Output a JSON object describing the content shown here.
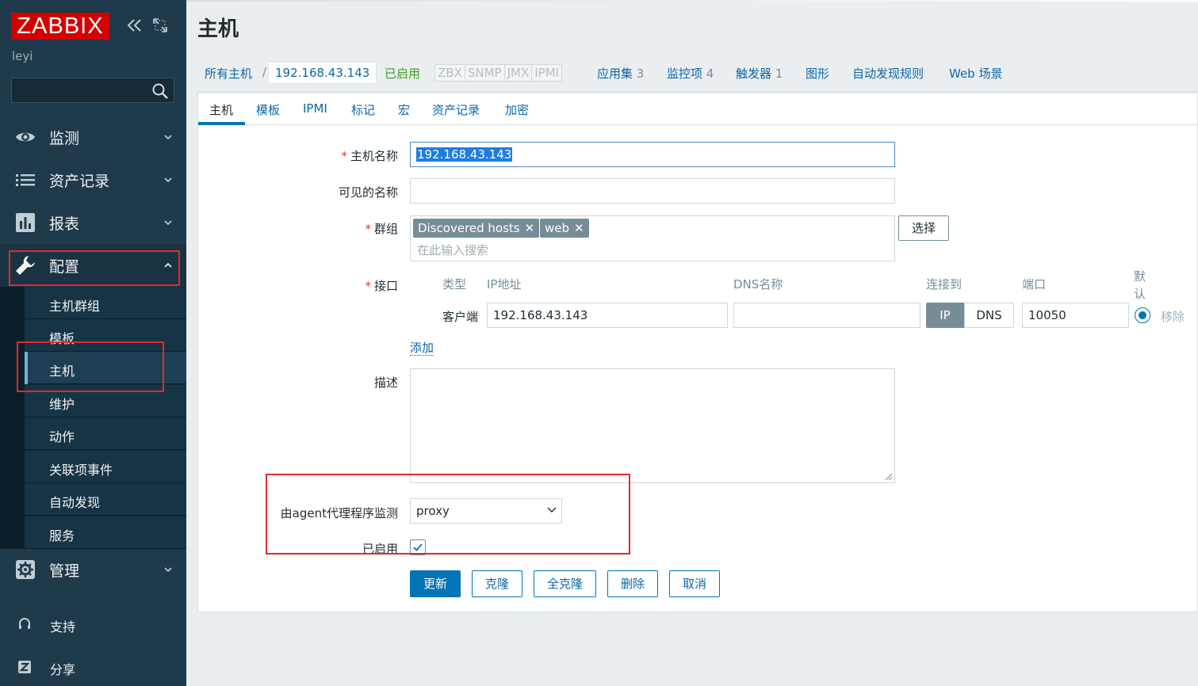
{
  "sidebar": {
    "logo": "ZABBIX",
    "user": "leyi",
    "menu": [
      {
        "label": "监测"
      },
      {
        "label": "资产记录"
      },
      {
        "label": "报表"
      },
      {
        "label": "配置"
      },
      {
        "label": "管理"
      }
    ],
    "config_submenu": [
      {
        "label": "主机群组"
      },
      {
        "label": "模板"
      },
      {
        "label": "主机"
      },
      {
        "label": "维护"
      },
      {
        "label": "动作"
      },
      {
        "label": "关联项事件"
      },
      {
        "label": "自动发现"
      },
      {
        "label": "服务"
      }
    ],
    "bottom": [
      {
        "label": "支持"
      },
      {
        "label": "分享"
      }
    ]
  },
  "page": {
    "title": "主机"
  },
  "nav": {
    "all_hosts": "所有主机",
    "separator": "/",
    "current_host": "192.168.43.143",
    "status": "已启用",
    "availability": [
      "ZBX",
      "SNMP",
      "JMX",
      "IPMI"
    ],
    "links": [
      {
        "label": "应用集",
        "count": "3"
      },
      {
        "label": "监控项",
        "count": "4"
      },
      {
        "label": "触发器",
        "count": "1"
      },
      {
        "label": "图形",
        "count": ""
      },
      {
        "label": "自动发现规则",
        "count": ""
      },
      {
        "label": "Web 场景",
        "count": ""
      }
    ]
  },
  "tabs": [
    "主机",
    "模板",
    "IPMI",
    "标记",
    "宏",
    "资产记录",
    "加密"
  ],
  "form": {
    "hostname_label": "主机名称",
    "hostname_value": "192.168.43.143",
    "visible_name_label": "可见的名称",
    "visible_name_value": "",
    "groups_label": "群组",
    "groups": [
      "Discovered hosts",
      "web"
    ],
    "groups_placeholder": "在此输入搜索",
    "select_button": "选择",
    "interfaces_label": "接口",
    "iface_headers": {
      "type": "类型",
      "ip": "IP地址",
      "dns": "DNS名称",
      "connect": "连接到",
      "port": "端口",
      "default": "默认"
    },
    "iface_row": {
      "type": "客户端",
      "ip": "192.168.43.143",
      "dns": "",
      "connect_ip": "IP",
      "connect_dns": "DNS",
      "port": "10050",
      "remove": "移除"
    },
    "add_interface": "添加",
    "description_label": "描述",
    "proxy_label": "由agent代理程序监测",
    "proxy_value": "proxy",
    "enabled_label": "已启用",
    "buttons": {
      "update": "更新",
      "clone": "克隆",
      "full_clone": "全克隆",
      "delete": "删除",
      "cancel": "取消"
    }
  },
  "colors": {
    "sidebar_bg": "#1f3a4b",
    "logo_red": "#d40000",
    "accent_blue": "#0275b8",
    "link_blue": "#0b67a8",
    "enabled_green": "#3c9b1f",
    "annotation_red": "#e02b2b"
  },
  "icons": {
    "monitoring": "eye-icon",
    "inventory": "list-icon",
    "reports": "bar-chart-icon",
    "configuration": "wrench-icon",
    "administration": "gear-icon",
    "support": "headset-icon",
    "share": "z-share-icon",
    "search": "search-icon",
    "collapse": "double-chevron-left-icon",
    "kiosk": "fullscreen-icon"
  }
}
